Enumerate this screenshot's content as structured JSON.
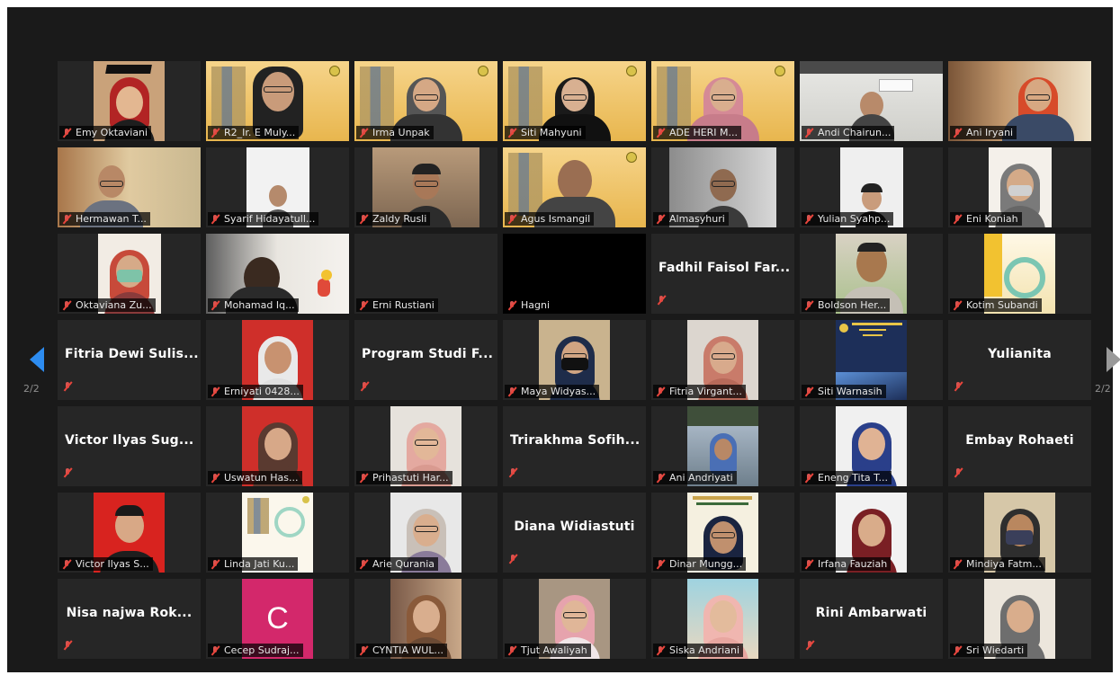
{
  "pagination": {
    "left_label": "2/2",
    "right_label": "2/2"
  },
  "colors": {
    "background": "#1a1a1a",
    "tile": "#262626",
    "accent": "#2d8cf0",
    "muted_mic": "#e8453c",
    "avatar_c": "#d3286b"
  },
  "participants": [
    {
      "label": "Emy Oktaviani"
    },
    {
      "label": "R2_Ir. E Muly..."
    },
    {
      "label": "Irma Unpak"
    },
    {
      "label": "Siti Mahyuni"
    },
    {
      "label": "ADE HERI M..."
    },
    {
      "label": "Andi Chairun..."
    },
    {
      "label": "Ani Iryani"
    },
    {
      "label": "Hermawan T..."
    },
    {
      "label": "Syarif Hidayatull..."
    },
    {
      "label": "Zaldy Rusli"
    },
    {
      "label": "Agus Ismangil"
    },
    {
      "label": "Almasyhuri"
    },
    {
      "label": "Yulian Syahp..."
    },
    {
      "label": "Eni Koniah"
    },
    {
      "label": "Oktaviana Zu..."
    },
    {
      "label": "Mohamad Iq..."
    },
    {
      "label": "Erni Rustiani"
    },
    {
      "label": "Hagni"
    },
    {
      "label": "Fadhil Faisol Far..."
    },
    {
      "label": "Boldson Her..."
    },
    {
      "label": "Kotim Subandi"
    },
    {
      "label": "Fitria Dewi Sulis..."
    },
    {
      "label": "Erniyati 0428..."
    },
    {
      "label": "Program Studi F..."
    },
    {
      "label": "Maya Widyas..."
    },
    {
      "label": "Fitria Virgant..."
    },
    {
      "label": "Siti Warnasih"
    },
    {
      "label": "Yulianita"
    },
    {
      "label": "Victor Ilyas Sug..."
    },
    {
      "label": "Uswatun Has..."
    },
    {
      "label": "Prihastuti Har..."
    },
    {
      "label": "Trirakhma Sofih..."
    },
    {
      "label": "Ani Andriyati"
    },
    {
      "label": "Eneng Tita T..."
    },
    {
      "label": "Embay Rohaeti"
    },
    {
      "label": "Victor Ilyas S..."
    },
    {
      "label": "Linda Jati Ku..."
    },
    {
      "label": "Arie Qurania"
    },
    {
      "label": "Diana Widiastuti"
    },
    {
      "label": "Dinar Mungg..."
    },
    {
      "label": "Irfana Fauziah"
    },
    {
      "label": "Mindiya Fatm..."
    },
    {
      "label": "Nisa najwa Rok..."
    },
    {
      "label": "Cecep Sudraj..."
    },
    {
      "label": "CYNTIA WUL..."
    },
    {
      "label": "Tjut Awaliyah"
    },
    {
      "label": "Siska Andriani"
    },
    {
      "label": "Rini Ambarwati"
    },
    {
      "label": "Sri Wiedarti"
    }
  ],
  "avatar_initial": "C",
  "icons": {
    "mic": "mic-muted-icon",
    "prev": "chevron-left-icon",
    "next": "chevron-right-icon"
  }
}
